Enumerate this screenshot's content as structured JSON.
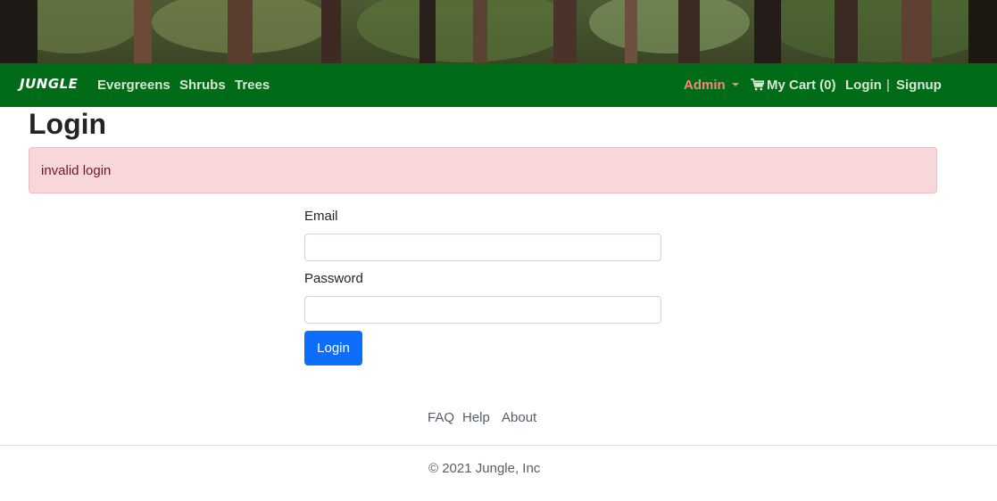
{
  "nav": {
    "brand": "JUNGLE",
    "links": [
      {
        "label": "Evergreens"
      },
      {
        "label": "Shrubs"
      },
      {
        "label": "Trees"
      }
    ],
    "admin": "Admin",
    "cart": "My Cart (0)",
    "login": "Login",
    "divider": "|",
    "signup": "Signup"
  },
  "page": {
    "title": "Login",
    "alert": "invalid login"
  },
  "form": {
    "email_label": "Email",
    "email_value": "",
    "password_label": "Password",
    "password_value": "",
    "submit_label": "Login"
  },
  "footer": {
    "links": [
      {
        "label": "FAQ"
      },
      {
        "label": "Help"
      },
      {
        "label": "About"
      }
    ],
    "copyright": "© 2021 Jungle, Inc"
  },
  "colors": {
    "navbar": "#016c17",
    "admin": "#f08a78",
    "alert_bg": "#f8d7da",
    "button": "#0d6efd"
  },
  "icons": [
    "cart-icon",
    "caret-down-icon"
  ]
}
